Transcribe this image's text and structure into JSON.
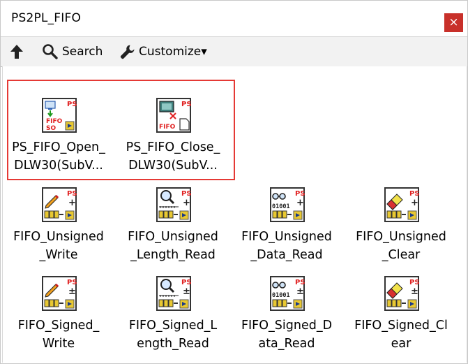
{
  "window": {
    "title": "PS2PL_FIFO",
    "close_glyph": "×"
  },
  "toolbar": {
    "up_icon": "up-arrow-icon",
    "search_label": "Search",
    "customize_label": "Customize▾"
  },
  "palette": {
    "items": [
      {
        "name": "ps-fifo-open-vi",
        "icon": "fifo-open-icon",
        "lines": [
          "PS_FIFO_Open_",
          "DLW30(SubV..."
        ]
      },
      {
        "name": "ps-fifo-close-vi",
        "icon": "fifo-close-icon",
        "lines": [
          "PS_FIFO_Close_",
          "DLW30(SubV..."
        ]
      },
      {
        "name": "fifo-unsigned-write-vi",
        "icon": "write-icon",
        "lines": [
          "FIFO_Unsigned",
          "_Write"
        ]
      },
      {
        "name": "fifo-unsigned-length-read-vi",
        "icon": "length-icon",
        "lines": [
          "FIFO_Unsigned",
          "_Length_Read"
        ]
      },
      {
        "name": "fifo-unsigned-data-read-vi",
        "icon": "data-icon",
        "lines": [
          "FIFO_Unsigned",
          "_Data_Read"
        ]
      },
      {
        "name": "fifo-unsigned-clear-vi",
        "icon": "clear-icon",
        "lines": [
          "FIFO_Unsigned",
          "_Clear"
        ]
      },
      {
        "name": "fifo-signed-write-vi",
        "icon": "write-icon",
        "lines": [
          "FIFO_Signed_",
          "Write"
        ]
      },
      {
        "name": "fifo-signed-length-read-vi",
        "icon": "length-icon",
        "lines": [
          "FIFO_Signed_L",
          "ength_Read"
        ]
      },
      {
        "name": "fifo-signed-data-read-vi",
        "icon": "data-icon",
        "lines": [
          "FIFO_Signed_D",
          "ata_Read"
        ]
      },
      {
        "name": "fifo-signed-clear-vi",
        "icon": "clear-icon",
        "lines": [
          "FIFO_Signed_Cl",
          "ear"
        ]
      }
    ],
    "icon_text": {
      "ps": "PS",
      "fifo": "FIFO",
      "so": "SO",
      "plus": "+",
      "plusminus": "±",
      "bits": "01001"
    },
    "colors": {
      "ps_red": "#e02020",
      "chip_yellow": "#e8c832",
      "highlight_red": "#e53935"
    }
  }
}
